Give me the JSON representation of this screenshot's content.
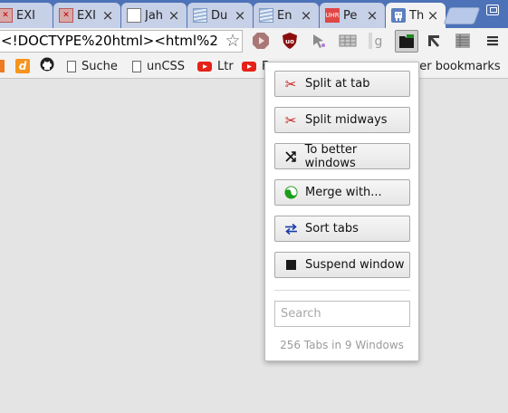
{
  "tabs": [
    {
      "title": "EXI"
    },
    {
      "title": "EXI"
    },
    {
      "title": "Jah"
    },
    {
      "title": "Du"
    },
    {
      "title": "En"
    },
    {
      "title": "Pe"
    },
    {
      "title": "Th"
    }
  ],
  "address_bar": {
    "value": "<!DOCTYPE%20html><html%2"
  },
  "bookmarks": {
    "items": [
      {
        "label": "Suche"
      },
      {
        "label": "unCSS"
      },
      {
        "label": "Ltr"
      },
      {
        "label": "F"
      },
      {
        "label": "ner bookmarks"
      }
    ]
  },
  "popup": {
    "buttons": [
      {
        "label": "Split at tab",
        "icon": "scissors-icon"
      },
      {
        "label": "Split midways",
        "icon": "scissors-icon"
      },
      {
        "label": "To better windows",
        "icon": "shuffle-icon"
      },
      {
        "label": "Merge with...",
        "icon": "yin-yang-icon"
      },
      {
        "label": "Sort tabs",
        "icon": "swap-arrows-icon"
      },
      {
        "label": "Suspend window",
        "icon": "stop-square-icon"
      }
    ],
    "search_placeholder": "Search",
    "status": "256 Tabs in 9 Windows"
  },
  "colors": {
    "tabstrip": "#4d72b8",
    "scissors": "#d11919",
    "accent_blue": "#1a3ea8",
    "yin_yang": "#1a9e1a"
  }
}
